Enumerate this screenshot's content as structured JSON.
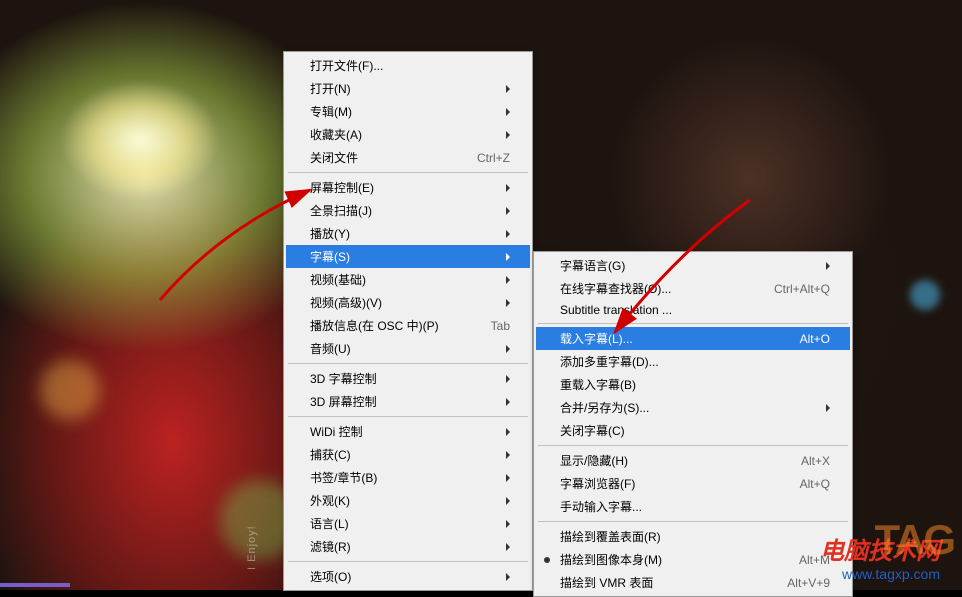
{
  "main_menu": {
    "groups": [
      [
        {
          "label": "打开文件(F)...",
          "shortcut": "",
          "arrow": false
        },
        {
          "label": "打开(N)",
          "shortcut": "",
          "arrow": true
        },
        {
          "label": "专辑(M)",
          "shortcut": "",
          "arrow": true
        },
        {
          "label": "收藏夹(A)",
          "shortcut": "",
          "arrow": true
        },
        {
          "label": "关闭文件",
          "shortcut": "Ctrl+Z",
          "arrow": false
        }
      ],
      [
        {
          "label": "屏幕控制(E)",
          "shortcut": "",
          "arrow": true
        },
        {
          "label": "全景扫描(J)",
          "shortcut": "",
          "arrow": true
        },
        {
          "label": "播放(Y)",
          "shortcut": "",
          "arrow": true
        },
        {
          "label": "字幕(S)",
          "shortcut": "",
          "arrow": true,
          "selected": true
        },
        {
          "label": "视频(基础)",
          "shortcut": "",
          "arrow": true
        },
        {
          "label": "视频(高级)(V)",
          "shortcut": "",
          "arrow": true
        },
        {
          "label": "播放信息(在 OSC 中)(P)",
          "shortcut": "Tab",
          "arrow": false
        },
        {
          "label": "音频(U)",
          "shortcut": "",
          "arrow": true
        }
      ],
      [
        {
          "label": "3D 字幕控制",
          "shortcut": "",
          "arrow": true
        },
        {
          "label": "3D 屏幕控制",
          "shortcut": "",
          "arrow": true
        }
      ],
      [
        {
          "label": "WiDi 控制",
          "shortcut": "",
          "arrow": true
        },
        {
          "label": "捕获(C)",
          "shortcut": "",
          "arrow": true
        },
        {
          "label": "书签/章节(B)",
          "shortcut": "",
          "arrow": true
        },
        {
          "label": "外观(K)",
          "shortcut": "",
          "arrow": true
        },
        {
          "label": "语言(L)",
          "shortcut": "",
          "arrow": true
        },
        {
          "label": "滤镜(R)",
          "shortcut": "",
          "arrow": true
        }
      ],
      [
        {
          "label": "选项(O)",
          "shortcut": "",
          "arrow": true
        }
      ]
    ]
  },
  "sub_menu": {
    "groups": [
      [
        {
          "label": "字幕语言(G)",
          "shortcut": "",
          "arrow": true
        },
        {
          "label": "在线字幕查找器(O)...",
          "shortcut": "Ctrl+Alt+Q",
          "arrow": false
        },
        {
          "label": "Subtitle translation ...",
          "shortcut": "",
          "arrow": false
        }
      ],
      [
        {
          "label": "载入字幕(L)...",
          "shortcut": "Alt+O",
          "arrow": false,
          "selected": true
        },
        {
          "label": "添加多重字幕(D)...",
          "shortcut": "",
          "arrow": false
        },
        {
          "label": "重载入字幕(B)",
          "shortcut": "",
          "arrow": false
        },
        {
          "label": "合并/另存为(S)...",
          "shortcut": "",
          "arrow": true
        },
        {
          "label": "关闭字幕(C)",
          "shortcut": "",
          "arrow": false
        }
      ],
      [
        {
          "label": "显示/隐藏(H)",
          "shortcut": "Alt+X",
          "arrow": false
        },
        {
          "label": "字幕浏览器(F)",
          "shortcut": "Alt+Q",
          "arrow": false
        },
        {
          "label": "手动输入字幕...",
          "shortcut": "",
          "arrow": false
        }
      ],
      [
        {
          "label": "描绘到覆盖表面(R)",
          "shortcut": "",
          "arrow": false
        },
        {
          "label": "描绘到图像本身(M)",
          "shortcut": "Alt+M",
          "arrow": false,
          "radio": true
        },
        {
          "label": "描绘到 VMR 表面",
          "shortcut": "Alt+V+9",
          "arrow": false
        }
      ]
    ]
  },
  "watermark": {
    "text": "电脑技术网",
    "url": "www.tagxp.com",
    "tag": "TAG"
  },
  "vertical_text": "I Enjoy!"
}
